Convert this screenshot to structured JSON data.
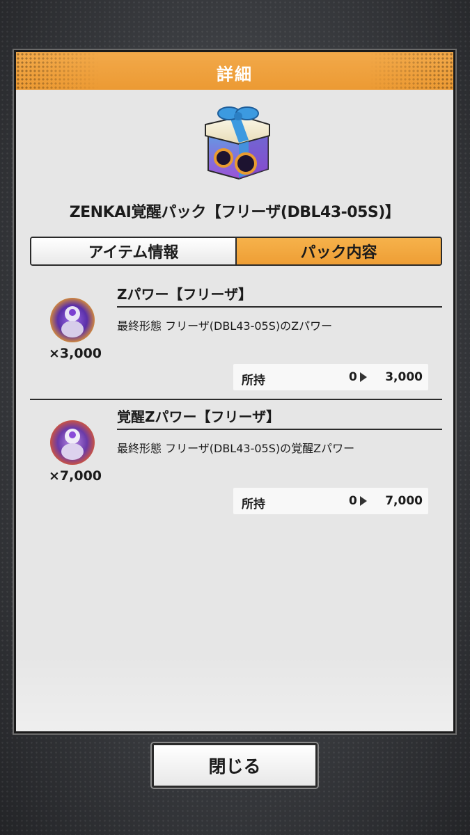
{
  "dialog": {
    "title": "詳細",
    "pack_name": "ZENKAI覚醒パック【フリーザ(DBL43-05S)】",
    "gift_icon": "gift-box-icon"
  },
  "tabs": [
    {
      "label": "アイテム情報",
      "active": false
    },
    {
      "label": "パック内容",
      "active": true
    }
  ],
  "items": [
    {
      "icon": "frieza-z-power-icon",
      "quantity": "×3,000",
      "title": "Zパワー【フリーザ】",
      "description": "最終形態 フリーザ(DBL43-05S)のZパワー",
      "owned_label": "所持",
      "owned_current": "0",
      "owned_new": "3,000"
    },
    {
      "icon": "frieza-awaken-z-power-icon",
      "quantity": "×7,000",
      "title": "覚醒Zパワー【フリーザ】",
      "description": "最終形態 フリーザ(DBL43-05S)の覚醒Zパワー",
      "owned_label": "所持",
      "owned_current": "0",
      "owned_new": "7,000"
    }
  ],
  "close_button": {
    "label": "閉じる"
  },
  "colors": {
    "accent": "#ee9e35",
    "panel": "#e6e6e6"
  }
}
